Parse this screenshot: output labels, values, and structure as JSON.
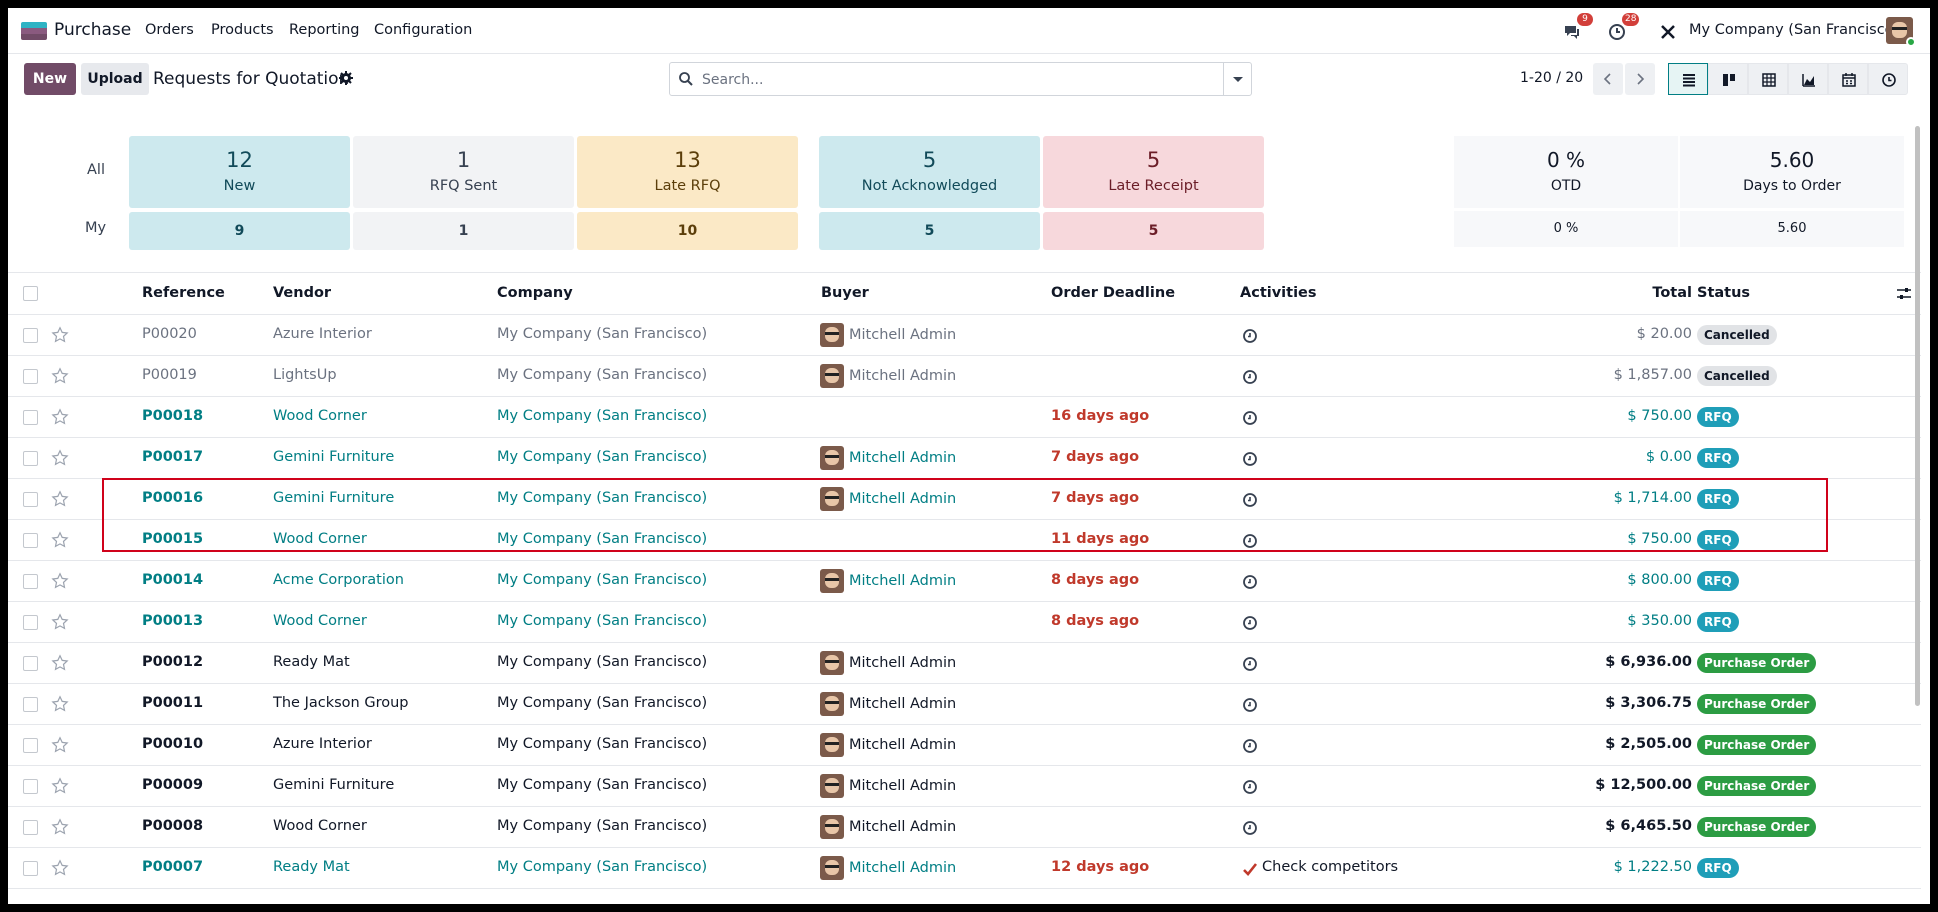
{
  "navbar": {
    "app_name": "Purchase",
    "menu": [
      "Orders",
      "Products",
      "Reporting",
      "Configuration"
    ],
    "messages_count": "9",
    "activities_count": "28",
    "company": "My Company (San Francisco)"
  },
  "control": {
    "new_label": "New",
    "upload_label": "Upload",
    "title": "Requests for Quotation",
    "search_placeholder": "Search...",
    "pager": "1-20 / 20"
  },
  "dashboard": {
    "all_label": "All",
    "my_label": "My",
    "cards": [
      {
        "value": "12",
        "label": "New",
        "my": "9",
        "bg": "#cde9ee",
        "fg": "#114a59"
      },
      {
        "value": "1",
        "label": "RFQ Sent",
        "my": "1",
        "bg": "#f2f3f5",
        "fg": "#374151"
      },
      {
        "value": "13",
        "label": "Late RFQ",
        "my": "10",
        "bg": "#fbe9c6",
        "fg": "#5b3e0a"
      },
      {
        "value": "5",
        "label": "Not Acknowledged",
        "my": "5",
        "bg": "#cde9ee",
        "fg": "#114a59"
      },
      {
        "value": "5",
        "label": "Late Receipt",
        "my": "5",
        "bg": "#f7d8dc",
        "fg": "#6b1d27"
      }
    ],
    "stats": [
      {
        "value": "0 %",
        "label": "OTD",
        "my": "0 %"
      },
      {
        "value": "5.60",
        "label": "Days to Order",
        "my": "5.60"
      }
    ]
  },
  "table": {
    "columns": {
      "reference": "Reference",
      "vendor": "Vendor",
      "company": "Company",
      "buyer": "Buyer",
      "deadline": "Order Deadline",
      "activities": "Activities",
      "total": "Total",
      "status": "Status"
    },
    "rows": [
      {
        "ref": "P00020",
        "vendor": "Azure Interior",
        "company": "My Company (San Francisco)",
        "buyer": "Mitchell Admin",
        "deadline": "",
        "activity": "",
        "total": "$ 20.00",
        "status": "Cancelled",
        "kind": "cancelled"
      },
      {
        "ref": "P00019",
        "vendor": "LightsUp",
        "company": "My Company (San Francisco)",
        "buyer": "Mitchell Admin",
        "deadline": "",
        "activity": "",
        "total": "$ 1,857.00",
        "status": "Cancelled",
        "kind": "cancelled"
      },
      {
        "ref": "P00018",
        "vendor": "Wood Corner",
        "company": "My Company (San Francisco)",
        "buyer": "",
        "deadline": "16 days ago",
        "activity": "",
        "total": "$ 750.00",
        "status": "RFQ",
        "kind": "rfq"
      },
      {
        "ref": "P00017",
        "vendor": "Gemini Furniture",
        "company": "My Company (San Francisco)",
        "buyer": "Mitchell Admin",
        "deadline": "7 days ago",
        "activity": "",
        "total": "$ 0.00",
        "status": "RFQ",
        "kind": "rfq"
      },
      {
        "ref": "P00016",
        "vendor": "Gemini Furniture",
        "company": "My Company (San Francisco)",
        "buyer": "Mitchell Admin",
        "deadline": "7 days ago",
        "activity": "",
        "total": "$ 1,714.00",
        "status": "RFQ",
        "kind": "rfq"
      },
      {
        "ref": "P00015",
        "vendor": "Wood Corner",
        "company": "My Company (San Francisco)",
        "buyer": "",
        "deadline": "11 days ago",
        "activity": "",
        "total": "$ 750.00",
        "status": "RFQ",
        "kind": "rfq"
      },
      {
        "ref": "P00014",
        "vendor": "Acme Corporation",
        "company": "My Company (San Francisco)",
        "buyer": "Mitchell Admin",
        "deadline": "8 days ago",
        "activity": "",
        "total": "$ 800.00",
        "status": "RFQ",
        "kind": "rfq"
      },
      {
        "ref": "P00013",
        "vendor": "Wood Corner",
        "company": "My Company (San Francisco)",
        "buyer": "",
        "deadline": "8 days ago",
        "activity": "",
        "total": "$ 350.00",
        "status": "RFQ",
        "kind": "rfq"
      },
      {
        "ref": "P00012",
        "vendor": "Ready Mat",
        "company": "My Company (San Francisco)",
        "buyer": "Mitchell Admin",
        "deadline": "",
        "activity": "",
        "total": "$ 6,936.00",
        "status": "Purchase Order",
        "kind": "po"
      },
      {
        "ref": "P00011",
        "vendor": "The Jackson Group",
        "company": "My Company (San Francisco)",
        "buyer": "Mitchell Admin",
        "deadline": "",
        "activity": "",
        "total": "$ 3,306.75",
        "status": "Purchase Order",
        "kind": "po"
      },
      {
        "ref": "P00010",
        "vendor": "Azure Interior",
        "company": "My Company (San Francisco)",
        "buyer": "Mitchell Admin",
        "deadline": "",
        "activity": "",
        "total": "$ 2,505.00",
        "status": "Purchase Order",
        "kind": "po"
      },
      {
        "ref": "P00009",
        "vendor": "Gemini Furniture",
        "company": "My Company (San Francisco)",
        "buyer": "Mitchell Admin",
        "deadline": "",
        "activity": "",
        "total": "$ 12,500.00",
        "status": "Purchase Order",
        "kind": "po"
      },
      {
        "ref": "P00008",
        "vendor": "Wood Corner",
        "company": "My Company (San Francisco)",
        "buyer": "Mitchell Admin",
        "deadline": "",
        "activity": "",
        "total": "$ 6,465.50",
        "status": "Purchase Order",
        "kind": "po"
      },
      {
        "ref": "P00007",
        "vendor": "Ready Mat",
        "company": "My Company (San Francisco)",
        "buyer": "Mitchell Admin",
        "deadline": "12 days ago",
        "activity": "Check competitors",
        "total": "$ 1,222.50",
        "status": "RFQ",
        "kind": "rfq"
      }
    ]
  },
  "colors": {
    "brand": "#714b67",
    "link": "#017e84",
    "late": "#c0392b",
    "rfq_badge": "#1f9eb8",
    "po_badge": "#2c9c43",
    "cancelled_badge": "#e1e3e6",
    "highlight": "#d0021b"
  }
}
